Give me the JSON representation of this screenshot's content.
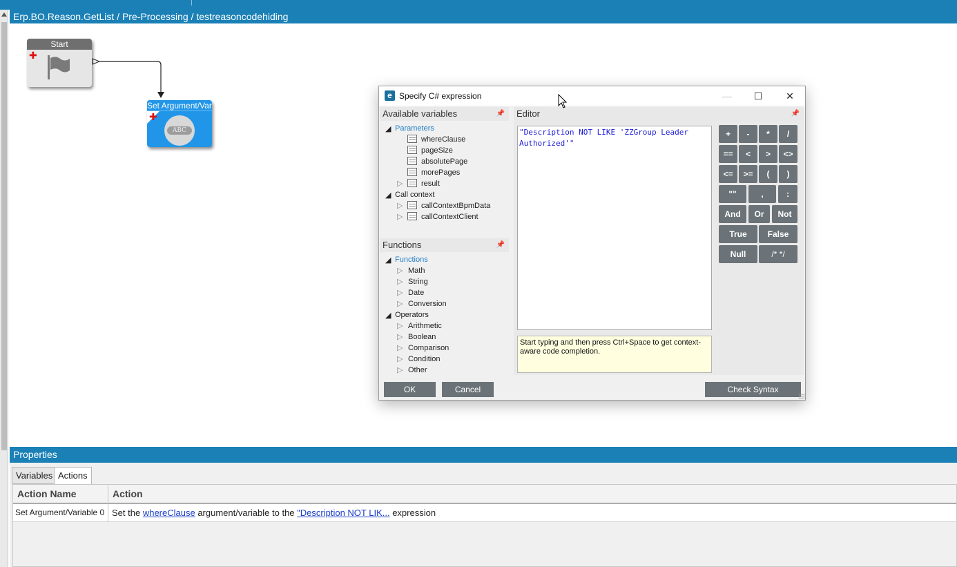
{
  "breadcrumb": "Erp.BO.Reason.GetList / Pre-Processing / testreasoncodehiding",
  "workflow": {
    "start_node": {
      "title": "Start"
    },
    "set_node": {
      "title": "Set Argument/Vari",
      "badge": "ABC"
    }
  },
  "dialog": {
    "title": "Specify C# expression",
    "logo_letter": "e",
    "minimize": "—",
    "maximize": "☐",
    "close": "✕",
    "variables_header": "Available variables",
    "variables_tree": {
      "parameters": {
        "label": "Parameters",
        "children": [
          "whereClause",
          "pageSize",
          "absolutePage",
          "morePages",
          "result"
        ]
      },
      "call_context": {
        "label": "Call context",
        "children": [
          "callContextBpmData",
          "callContextClient"
        ]
      }
    },
    "functions_header": "Functions",
    "functions_tree": {
      "functions": {
        "label": "Functions",
        "children": [
          "Math",
          "String",
          "Date",
          "Conversion"
        ]
      },
      "operators": {
        "label": "Operators",
        "children": [
          "Arithmetic",
          "Boolean",
          "Comparison",
          "Condition",
          "Other"
        ]
      }
    },
    "editor_header": "Editor",
    "editor_text": "\"Description NOT LIKE 'ZZGroup Leader Authorized'\"",
    "hint_text": "Start typing and then press Ctrl+Space to get context-aware code completion.",
    "keypad": {
      "row1": [
        "+",
        "-",
        "*",
        "/"
      ],
      "row2": [
        "==",
        "<",
        ">",
        "<>"
      ],
      "row3": [
        "<=",
        ">=",
        "(",
        ")"
      ],
      "row4": [
        "\"\"",
        ",",
        ":"
      ],
      "row5": [
        "And",
        "Or",
        "Not"
      ],
      "row6": [
        "True",
        "False"
      ],
      "row7": [
        "Null",
        "/* */"
      ]
    },
    "ok_label": "OK",
    "cancel_label": "Cancel",
    "check_syntax_label": "Check Syntax"
  },
  "properties": {
    "header": "Properties",
    "tabs": [
      "Variables",
      "Actions"
    ],
    "active_tab": "Actions",
    "columns": [
      "Action Name",
      "Action"
    ],
    "rows": [
      {
        "name": "Set Argument/Variable 0",
        "action_prefix": "Set the",
        "action_link1": "whereClause",
        "action_middle": "argument/variable to the",
        "action_link2": "\"Description NOT LIK...",
        "action_suffix": "expression"
      }
    ]
  },
  "colors": {
    "accent": "#1a80b6",
    "node_start": "#6f6f6f",
    "node_set": "#2196e8",
    "keypad": "#6b7378",
    "tree_blue": "#1a7ac4"
  }
}
